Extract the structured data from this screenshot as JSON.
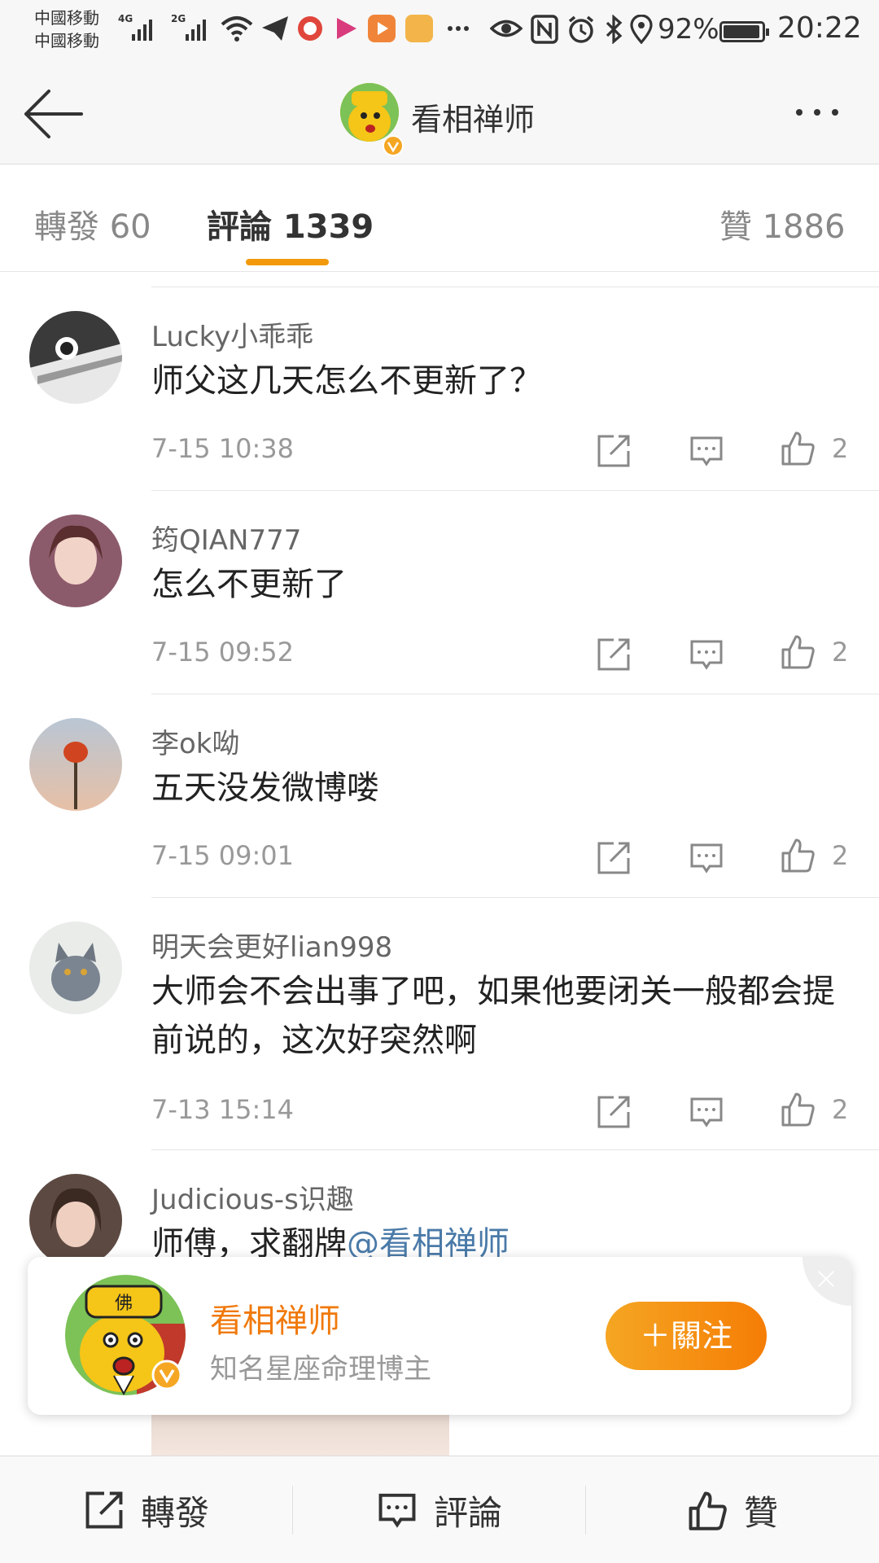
{
  "status_bar": {
    "carrier_1": "中國移動",
    "carrier_2": "中國移動",
    "network_1": "4G",
    "network_2": "2G",
    "battery": "92%",
    "time": "20:22",
    "icons": [
      "wifi-icon",
      "telegram-icon",
      "weibo-app-icon",
      "youku-icon",
      "video-app-icon",
      "app-icon",
      "more-notifications-icon",
      "eye-icon",
      "nfc-icon",
      "alarm-icon",
      "bluetooth-icon",
      "location-icon",
      "battery-icon"
    ]
  },
  "navbar": {
    "title": "看相禅师",
    "back_icon": "back-arrow-icon",
    "more_icon": "more-dots-icon"
  },
  "tabs": [
    {
      "label": "轉發 60"
    },
    {
      "label": "評論 1339",
      "active": true
    },
    {
      "label": "贊 1886"
    }
  ],
  "comments": [
    {
      "name": "Lucky小乖乖",
      "text": "师父这几天怎么不更新了？",
      "time": "7-15 10:38",
      "likes": "2"
    },
    {
      "name": "筠QIAN777",
      "text": "怎么不更新了",
      "time": "7-15 09:52",
      "likes": "2"
    },
    {
      "name": "李ok呦",
      "text": "五天没发微博喽",
      "time": "7-15 09:01",
      "likes": "2"
    },
    {
      "name": "明天会更好lian998",
      "text": "大师会不会出事了吧，如果他要闭关一般都会提前说的，这次好突然啊",
      "time": "7-13 15:14",
      "likes": "2"
    },
    {
      "name": "Judicious-s识趣",
      "text": "师傅，求翻牌",
      "mention": "@看相禅师"
    }
  ],
  "follow_card": {
    "name": "看相禅师",
    "description": "知名星座命理博主",
    "follow_label": "＋關注",
    "badge_char": "佛"
  },
  "bottom_bar": {
    "repost": "轉發",
    "comment": "評論",
    "like": "贊"
  },
  "colors": {
    "accent": "#f29a0c",
    "follow_gradient_start": "#f5a623",
    "follow_gradient_end": "#f57d05",
    "card_name": "#f0790b",
    "mention": "#4a7aa8"
  }
}
